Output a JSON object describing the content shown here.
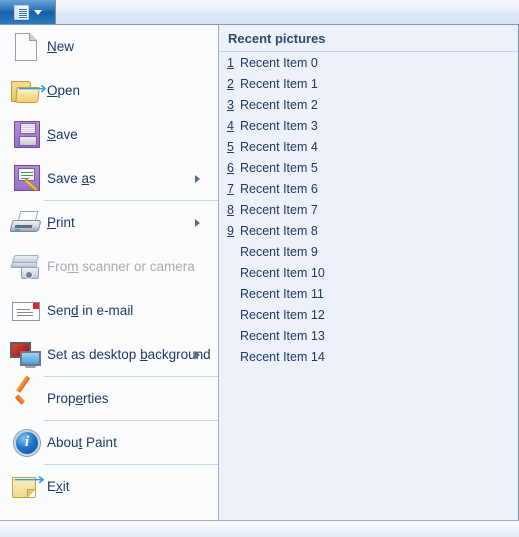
{
  "window": {
    "title_button_label": "Paint menu"
  },
  "menu": {
    "items": [
      {
        "label_pre": "",
        "label_acc": "N",
        "label_post": "ew",
        "icon": "new-page-icon",
        "name": "new",
        "submenu": false,
        "disabled": false,
        "divider_after": false
      },
      {
        "label_pre": "",
        "label_acc": "O",
        "label_post": "pen",
        "icon": "open-folder-icon",
        "name": "open",
        "submenu": false,
        "disabled": false,
        "divider_after": false
      },
      {
        "label_pre": "",
        "label_acc": "S",
        "label_post": "ave",
        "icon": "floppy-disk-icon",
        "name": "save",
        "submenu": false,
        "disabled": false,
        "divider_after": false
      },
      {
        "label_pre": "Save ",
        "label_acc": "a",
        "label_post": "s",
        "icon": "floppy-disk-pencil-icon",
        "name": "save-as",
        "submenu": true,
        "disabled": false,
        "divider_after": true
      },
      {
        "label_pre": "",
        "label_acc": "P",
        "label_post": "rint",
        "icon": "printer-icon",
        "name": "print",
        "submenu": true,
        "disabled": false,
        "divider_after": false
      },
      {
        "label_pre": "Fro",
        "label_acc": "m",
        "label_post": " scanner or camera",
        "icon": "scanner-camera-icon",
        "name": "from-scanner-or-camera",
        "submenu": false,
        "disabled": true,
        "divider_after": false
      },
      {
        "label_pre": "Sen",
        "label_acc": "d",
        "label_post": " in e-mail",
        "icon": "envelope-icon",
        "name": "send-in-email",
        "submenu": false,
        "disabled": false,
        "divider_after": false
      },
      {
        "label_pre": "Set as desktop ",
        "label_acc": "b",
        "label_post": "ackground",
        "icon": "desktop-monitors-icon",
        "name": "set-as-desktop-background",
        "submenu": true,
        "disabled": false,
        "divider_after": true
      },
      {
        "label_pre": "Prop",
        "label_acc": "e",
        "label_post": "rties",
        "icon": "orange-check-icon",
        "name": "properties",
        "submenu": false,
        "disabled": false,
        "divider_after": true
      },
      {
        "label_pre": "Abou",
        "label_acc": "t",
        "label_post": " Paint",
        "icon": "info-circle-icon",
        "name": "about-paint",
        "submenu": false,
        "disabled": false,
        "divider_after": true
      },
      {
        "label_pre": "E",
        "label_acc": "x",
        "label_post": "it",
        "icon": "exit-folder-icon",
        "name": "exit",
        "submenu": false,
        "disabled": false,
        "divider_after": false
      }
    ]
  },
  "recent": {
    "header": "Recent pictures",
    "items": [
      {
        "num": "1",
        "name": "Recent Item 0"
      },
      {
        "num": "2",
        "name": "Recent Item 1"
      },
      {
        "num": "3",
        "name": "Recent Item 2"
      },
      {
        "num": "4",
        "name": "Recent Item 3"
      },
      {
        "num": "5",
        "name": "Recent Item 4"
      },
      {
        "num": "6",
        "name": "Recent Item 5"
      },
      {
        "num": "7",
        "name": "Recent Item 6"
      },
      {
        "num": "8",
        "name": "Recent Item 7"
      },
      {
        "num": "9",
        "name": "Recent Item 8"
      },
      {
        "num": "",
        "name": "Recent Item 9"
      },
      {
        "num": "",
        "name": "Recent Item 10"
      },
      {
        "num": "",
        "name": "Recent Item 11"
      },
      {
        "num": "",
        "name": "Recent Item 12"
      },
      {
        "num": "",
        "name": "Recent Item 13"
      },
      {
        "num": "",
        "name": "Recent Item 14"
      }
    ]
  },
  "colors": {
    "accent_blue": "#1f6db5",
    "text_blue": "#1f3864",
    "header_blue": "#2d4a6b",
    "disabled_gray": "#a8adb4",
    "right_pane_bg": "#edf1f9",
    "left_pane_bg": "#fbfcfd"
  }
}
